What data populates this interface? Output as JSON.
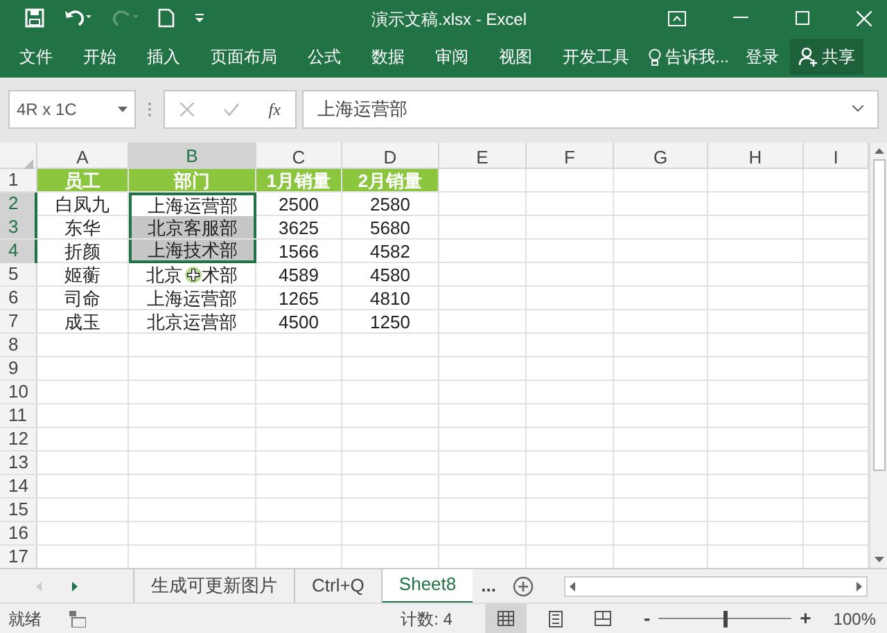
{
  "window": {
    "title": "演示文稿.xlsx - Excel"
  },
  "ribbon": {
    "tabs": [
      {
        "label": "文件"
      },
      {
        "label": "开始"
      },
      {
        "label": "插入"
      },
      {
        "label": "页面布局"
      },
      {
        "label": "公式"
      },
      {
        "label": "数据"
      },
      {
        "label": "审阅"
      },
      {
        "label": "视图"
      },
      {
        "label": "开发工具"
      }
    ],
    "tell_me": "告诉我...",
    "sign_in": "登录",
    "share": "共享"
  },
  "formula_bar": {
    "name_box": "4R x 1C",
    "fx": "fx",
    "value": "上海运营部"
  },
  "table": {
    "columns": [
      {
        "label": "A",
        "selected": false
      },
      {
        "label": "B",
        "selected": true
      },
      {
        "label": "C",
        "selected": false
      },
      {
        "label": "D",
        "selected": false
      },
      {
        "label": "E",
        "selected": false
      },
      {
        "label": "F",
        "selected": false
      },
      {
        "label": "G",
        "selected": false
      },
      {
        "label": "H",
        "selected": false
      },
      {
        "label": "I",
        "selected": false
      }
    ],
    "rows": [
      {
        "number": "1",
        "kind": "header",
        "selected": false,
        "cells": [
          {
            "text": "员工",
            "selected": false,
            "active": false
          },
          {
            "text": "部门",
            "selected": false,
            "active": false
          },
          {
            "text": "1月销量",
            "selected": false,
            "active": false
          },
          {
            "text": "2月销量",
            "selected": false,
            "active": false
          }
        ]
      },
      {
        "number": "2",
        "kind": "data",
        "selected": true,
        "cells": [
          {
            "text": "白凤九",
            "selected": false,
            "active": false
          },
          {
            "text": "上海运营部",
            "selected": true,
            "active": true
          },
          {
            "text": "2500",
            "selected": false,
            "active": false
          },
          {
            "text": "2580",
            "selected": false,
            "active": false
          }
        ]
      },
      {
        "number": "3",
        "kind": "data",
        "selected": true,
        "cells": [
          {
            "text": "东华",
            "selected": false,
            "active": false
          },
          {
            "text": "北京客服部",
            "selected": true,
            "active": false
          },
          {
            "text": "3625",
            "selected": false,
            "active": false
          },
          {
            "text": "5680",
            "selected": false,
            "active": false
          }
        ]
      },
      {
        "number": "4",
        "kind": "data",
        "selected": true,
        "cells": [
          {
            "text": "折颜",
            "selected": false,
            "active": false
          },
          {
            "text": "上海技术部",
            "selected": true,
            "active": false
          },
          {
            "text": "1566",
            "selected": false,
            "active": false
          },
          {
            "text": "4582",
            "selected": false,
            "active": false
          }
        ]
      },
      {
        "number": "5",
        "kind": "data",
        "selected": false,
        "cells": [
          {
            "text": "姬蘅",
            "selected": false,
            "active": false
          },
          {
            "text": "北京 术部",
            "selected": false,
            "active": false
          },
          {
            "text": "4589",
            "selected": false,
            "active": false
          },
          {
            "text": "4580",
            "selected": false,
            "active": false
          }
        ]
      },
      {
        "number": "6",
        "kind": "data",
        "selected": false,
        "cells": [
          {
            "text": "司命",
            "selected": false,
            "active": false
          },
          {
            "text": "上海运营部",
            "selected": false,
            "active": false
          },
          {
            "text": "1265",
            "selected": false,
            "active": false
          },
          {
            "text": "4810",
            "selected": false,
            "active": false
          }
        ]
      },
      {
        "number": "7",
        "kind": "data",
        "selected": false,
        "cells": [
          {
            "text": "成玉",
            "selected": false,
            "active": false
          },
          {
            "text": "北京运营部",
            "selected": false,
            "active": false
          },
          {
            "text": "4500",
            "selected": false,
            "active": false
          },
          {
            "text": "1250",
            "selected": false,
            "active": false
          }
        ]
      },
      {
        "number": "8",
        "kind": "empty",
        "selected": false
      },
      {
        "number": "9",
        "kind": "empty",
        "selected": false
      },
      {
        "number": "10",
        "kind": "empty",
        "selected": false
      },
      {
        "number": "11",
        "kind": "empty",
        "selected": false
      },
      {
        "number": "12",
        "kind": "empty",
        "selected": false
      },
      {
        "number": "13",
        "kind": "empty",
        "selected": false
      },
      {
        "number": "14",
        "kind": "empty",
        "selected": false
      },
      {
        "number": "15",
        "kind": "empty",
        "selected": false
      },
      {
        "number": "16",
        "kind": "empty",
        "selected": false
      },
      {
        "number": "17",
        "kind": "empty",
        "selected": false
      }
    ]
  },
  "sheet_tabs": [
    {
      "label": "生成可更新图片",
      "selected": false
    },
    {
      "label": "Ctrl+Q",
      "selected": false
    },
    {
      "label": "Sheet8",
      "selected": true
    }
  ],
  "more_sheets": "...",
  "status_bar": {
    "status": "就绪",
    "count": "计数: 4",
    "zoom": {
      "level": 0.5
    },
    "zoom_value": "100%",
    "zoom_out": "-",
    "zoom_in": "+"
  }
}
